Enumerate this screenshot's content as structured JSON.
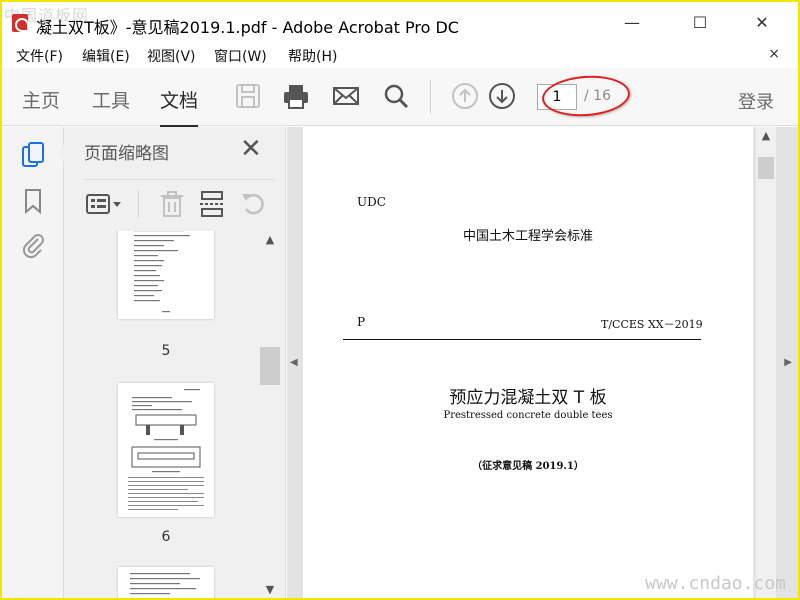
{
  "window": {
    "title": "凝土双T板》-意见稿2019.1.pdf - Adobe Acrobat Pro DC",
    "minimize_label": "—",
    "maximize_label": "☐",
    "close_label": "✕"
  },
  "watermarks": {
    "top_left": "中国道板网",
    "bottom_right": "www.cndao.com"
  },
  "menu": {
    "items": [
      {
        "label": "文件(F)"
      },
      {
        "label": "编辑(E)"
      },
      {
        "label": "视图(V)"
      },
      {
        "label": "窗口(W)"
      },
      {
        "label": "帮助(H)"
      }
    ],
    "close_label": "×"
  },
  "toolbar": {
    "tabs": [
      {
        "label": "主页"
      },
      {
        "label": "工具"
      },
      {
        "label": "文档"
      }
    ],
    "active_tab": "文档",
    "page_current": "1",
    "page_total": "/ 16",
    "login_label": "登录"
  },
  "thumbnail_panel": {
    "title": "页面缩略图",
    "close_label": "✕",
    "thumbnails": [
      {
        "page": "5"
      },
      {
        "page": "6"
      }
    ]
  },
  "document": {
    "udc": "UDC",
    "organization": "中国土木工程学会标准",
    "category": "P",
    "standard_code": "T/CCES XX－2019",
    "title_cn": "预应力混凝土双 T 板",
    "title_en": "Prestressed concrete double tees",
    "draft_note": "（征求意见稿 2019.1）"
  },
  "colors": {
    "frame": "#f2e600",
    "highlight_ellipse": "#e0201c",
    "active_tab_underline": "#2a2a2a"
  }
}
